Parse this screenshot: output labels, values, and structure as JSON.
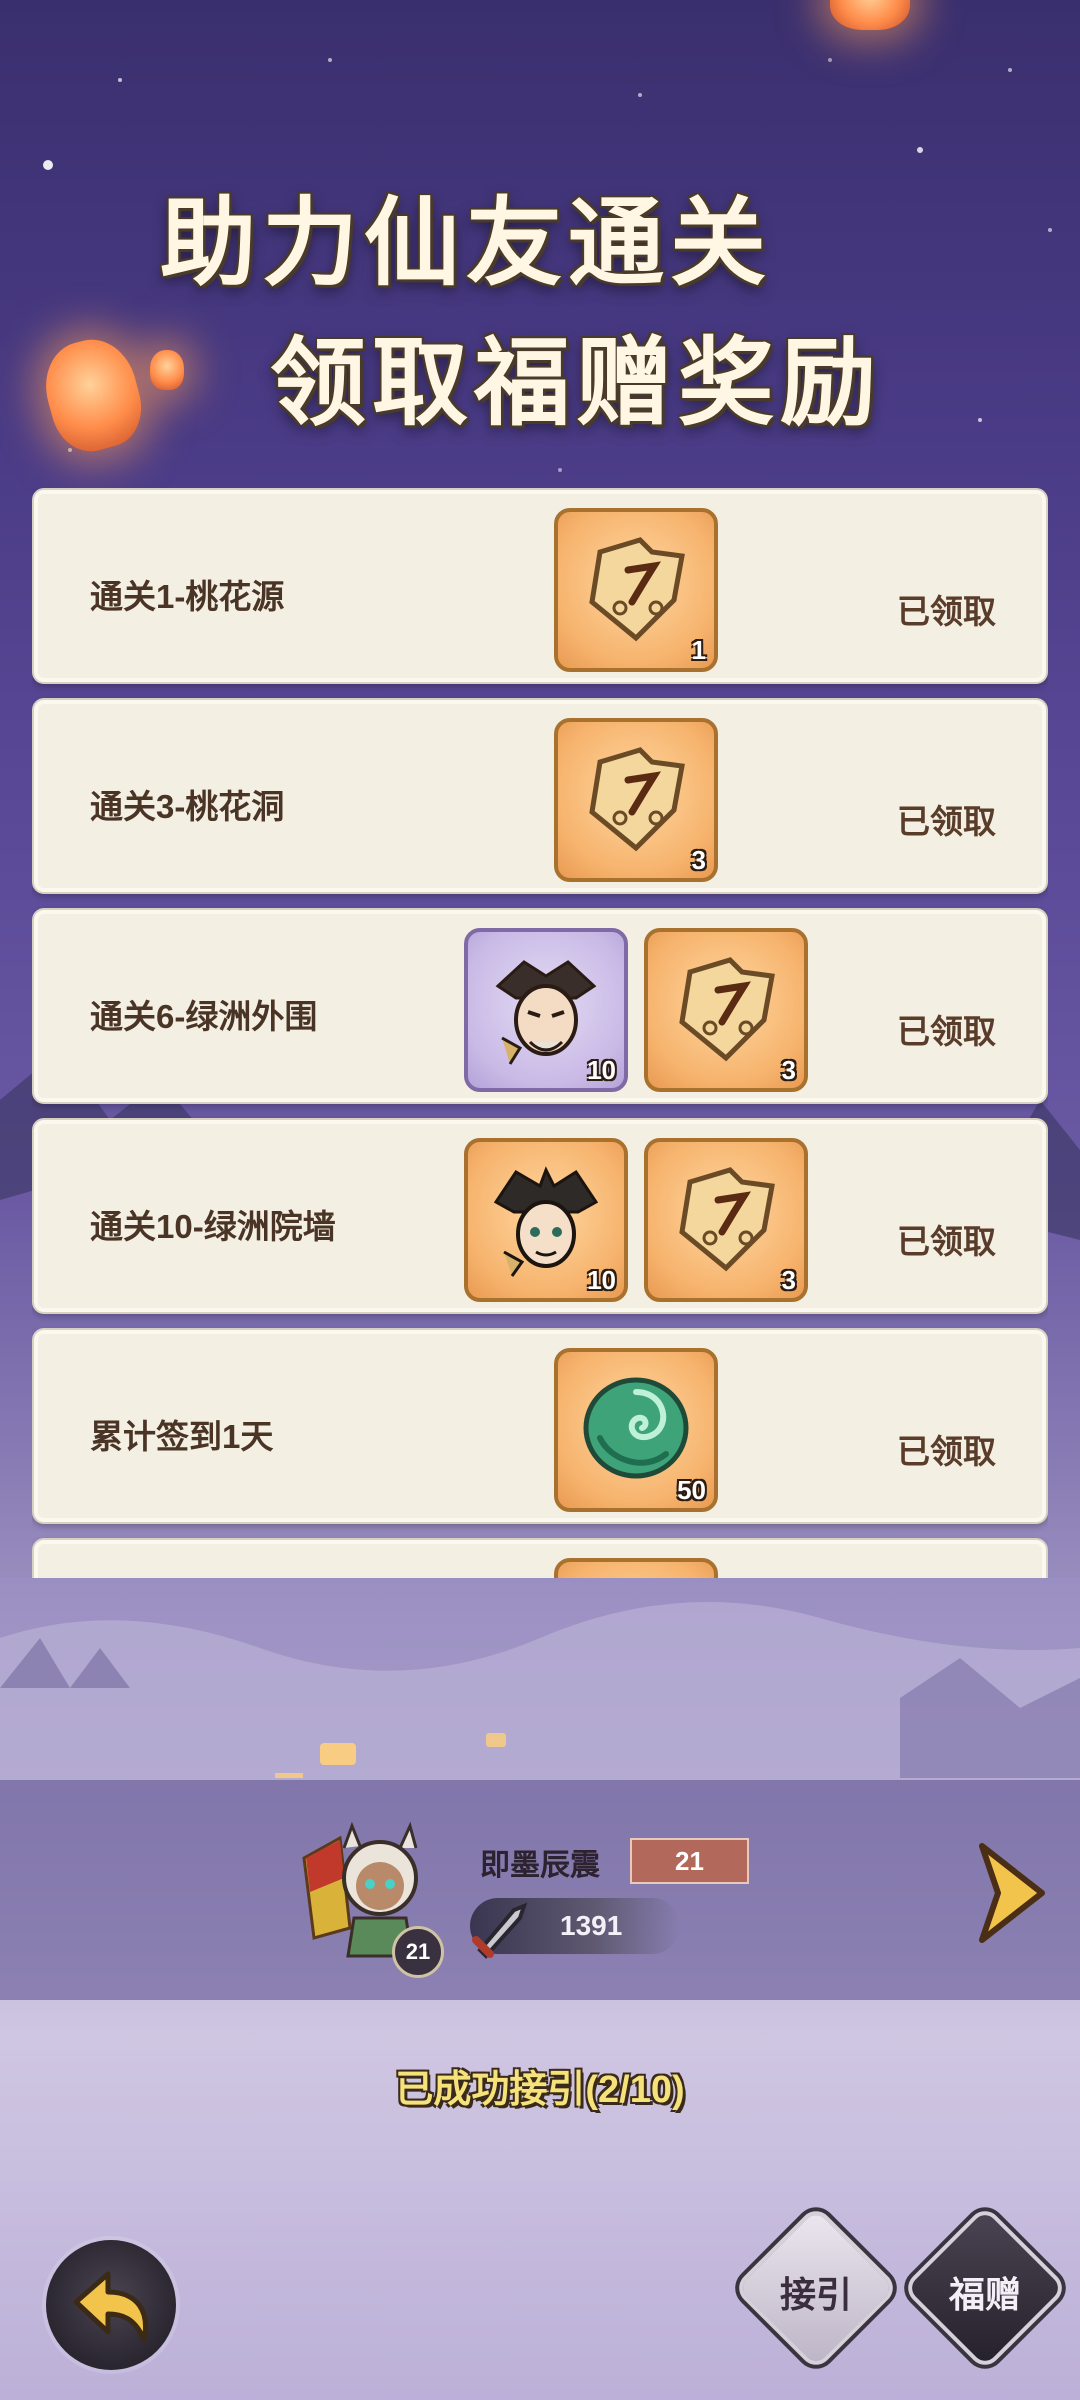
{
  "headline": {
    "line1": "助力仙友通关",
    "line2": "领取福赠奖励"
  },
  "rewards": [
    {
      "title": "通关1-桃花源",
      "status": "已领取",
      "items": [
        {
          "icon": "token-plate-icon",
          "qty": "1",
          "frame": "orange"
        }
      ]
    },
    {
      "title": "通关3-桃花洞",
      "status": "已领取",
      "items": [
        {
          "icon": "token-plate-icon",
          "qty": "3",
          "frame": "orange"
        }
      ]
    },
    {
      "title": "通关6-绿洲外围",
      "status": "已领取",
      "items": [
        {
          "icon": "hero-portrait-icon",
          "qty": "10",
          "frame": "purple"
        },
        {
          "icon": "token-plate-icon",
          "qty": "3",
          "frame": "orange"
        }
      ]
    },
    {
      "title": "通关10-绿洲院墙",
      "status": "已领取",
      "items": [
        {
          "icon": "hero-portrait-icon",
          "qty": "10",
          "frame": "orange"
        },
        {
          "icon": "token-plate-icon",
          "qty": "3",
          "frame": "orange"
        }
      ]
    },
    {
      "title": "累计签到1天",
      "status": "已领取",
      "items": [
        {
          "icon": "jade-swirl-icon",
          "qty": "50",
          "frame": "orange"
        }
      ]
    }
  ],
  "player": {
    "name": "即墨辰震",
    "level": "21",
    "avatar_level": "21",
    "power": "1391"
  },
  "progress_text": "已成功接引(2/10)",
  "buttons": {
    "invite": "接引",
    "gift": "福赠"
  }
}
